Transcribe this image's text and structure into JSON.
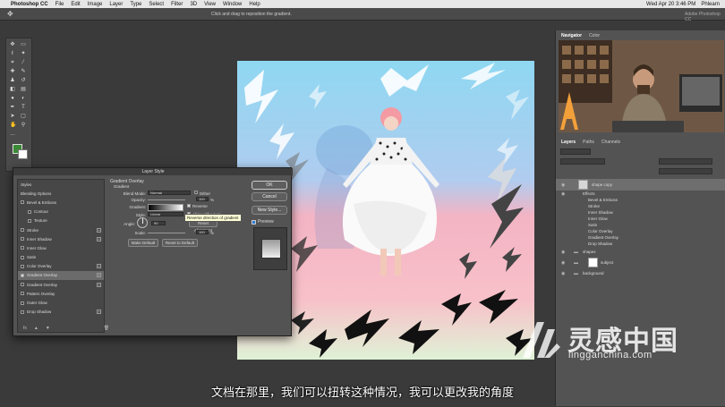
{
  "menubar": {
    "app": "Photoshop CC",
    "items": [
      "File",
      "Edit",
      "Image",
      "Layer",
      "Type",
      "Select",
      "Filter",
      "3D",
      "View",
      "Window",
      "Help"
    ],
    "clock": "Wed Apr 20  3:46 PM",
    "user": "Phlearn"
  },
  "optionsbar": {
    "hint": "Click and drag to reposition the gradient.",
    "workspace": "Adobe Photoshop CC"
  },
  "right_panel": {
    "nav_tabs": [
      "Navigator",
      "Color"
    ],
    "layer_tabs": [
      "Layers",
      "Paths",
      "Channels"
    ],
    "layers": [
      {
        "name": "shape copy",
        "selected": true,
        "kind": "layer"
      },
      {
        "name": "Effects",
        "kind": "effects"
      },
      {
        "name": "Bevel & Emboss",
        "kind": "effect"
      },
      {
        "name": "Stroke",
        "kind": "effect"
      },
      {
        "name": "Inner Shadow",
        "kind": "effect"
      },
      {
        "name": "Inner Glow",
        "kind": "effect"
      },
      {
        "name": "Satin",
        "kind": "effect"
      },
      {
        "name": "Color Overlay",
        "kind": "effect"
      },
      {
        "name": "Gradient Overlay",
        "kind": "effect"
      },
      {
        "name": "Drop Shadow",
        "kind": "effect"
      },
      {
        "name": "shapes",
        "kind": "folder"
      },
      {
        "name": "subject",
        "kind": "layer"
      },
      {
        "name": "background",
        "kind": "folder"
      }
    ]
  },
  "dialog": {
    "title": "Layer Style",
    "sidebar": [
      {
        "label": "Styles",
        "checkbox": false,
        "plus": false
      },
      {
        "label": "Blending Options",
        "checkbox": false,
        "plus": false
      },
      {
        "label": "Bevel & Emboss",
        "checkbox": true,
        "plus": false
      },
      {
        "label": "Contour",
        "checkbox": true,
        "plus": false,
        "indent": true
      },
      {
        "label": "Texture",
        "checkbox": true,
        "plus": false,
        "indent": true
      },
      {
        "label": "Stroke",
        "checkbox": true,
        "plus": true
      },
      {
        "label": "Inner Shadow",
        "checkbox": true,
        "plus": true
      },
      {
        "label": "Inner Glow",
        "checkbox": true,
        "plus": false
      },
      {
        "label": "Satin",
        "checkbox": true,
        "plus": false
      },
      {
        "label": "Color Overlay",
        "checkbox": true,
        "plus": true
      },
      {
        "label": "Gradient Overlay",
        "checkbox": true,
        "plus": true,
        "selected": true
      },
      {
        "label": "Gradient Overlay",
        "checkbox": true,
        "plus": true
      },
      {
        "label": "Pattern Overlay",
        "checkbox": true,
        "plus": false
      },
      {
        "label": "Outer Glow",
        "checkbox": true,
        "plus": false
      },
      {
        "label": "Drop Shadow",
        "checkbox": true,
        "plus": true
      }
    ],
    "section_title": "Gradient Overlay",
    "section_sub": "Gradient",
    "blend_mode_label": "Blend Mode:",
    "blend_mode": "Normal",
    "dither_label": "Dither",
    "opacity_label": "Opacity:",
    "opacity_value": "100",
    "opacity_unit": "%",
    "gradient_label": "Gradient:",
    "reverse_label": "Reverse",
    "style_label": "Style:",
    "style_value": "Linear",
    "align_label": "Align with Layer",
    "angle_label": "Angle:",
    "angle_value": "90",
    "reset_alignment": "Reset Alignment",
    "scale_label": "Scale:",
    "scale_value": "100",
    "scale_unit": "%",
    "make_default": "Make Default",
    "reset_default": "Reset to Default",
    "ok": "OK",
    "cancel": "Cancel",
    "new_style": "New Style...",
    "preview": "Preview",
    "tooltip": "Reverse direction of gradient"
  },
  "subtitle": "文档在那里，我们可以扭转这种情况，我可以更改我的角度",
  "watermark": {
    "cn": "灵感中国",
    "url": "lingganchina.com"
  },
  "colors": {
    "canvas_top": "#8fd8f2",
    "canvas_bottom": "#f8c1c9",
    "foreground": "#3a8a35"
  }
}
